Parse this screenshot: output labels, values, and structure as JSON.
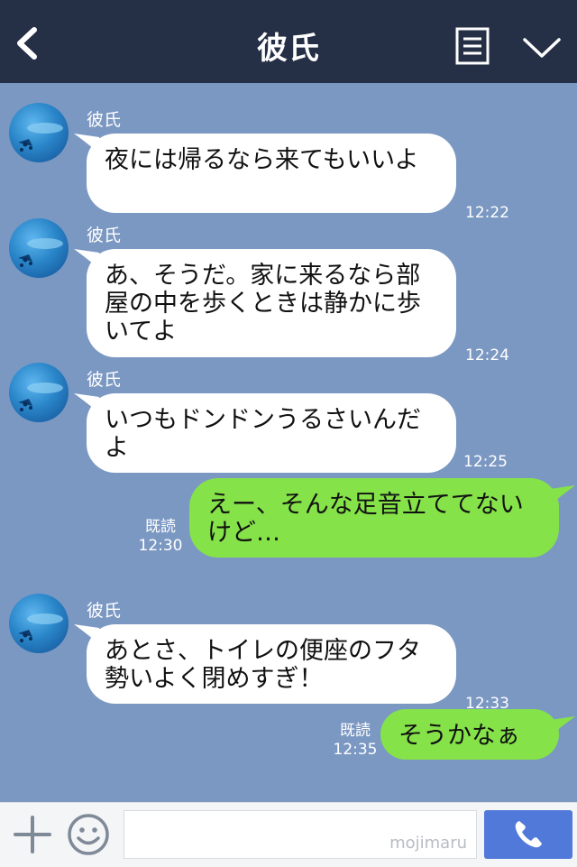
{
  "header": {
    "title": "彼氏",
    "back_icon": "back-chevron-icon",
    "menu_icon": "notes-icon",
    "chevron_icon": "chevron-down-icon",
    "background": "#252f45"
  },
  "chat": {
    "background": "#7b98c3",
    "messages": [
      {
        "direction": "incoming",
        "sender": "彼氏",
        "text": "夜には帰るなら来てもいいよ",
        "time": "12:22"
      },
      {
        "direction": "incoming",
        "sender": "彼氏",
        "text": "あ、そうだ。家に来るなら部屋の中を歩くときは静かに歩いてよ",
        "time": "12:24"
      },
      {
        "direction": "incoming",
        "sender": "彼氏",
        "text": "いつもドンドンうるさいんだよ",
        "time": "12:25"
      },
      {
        "direction": "outgoing",
        "read": "既読",
        "text": "えー、そんな足音立ててないけど…",
        "time": "12:30"
      },
      {
        "direction": "incoming",
        "sender": "彼氏",
        "text": "あとさ、トイレの便座のフタ勢いよく閉めすぎ！",
        "time": "12:33"
      },
      {
        "direction": "outgoing",
        "read": "既読",
        "text": "そうかなぁ",
        "time": "12:35"
      }
    ]
  },
  "input_bar": {
    "plus_icon": "plus-icon",
    "sticker_icon": "smile-icon",
    "watermark": "mojimaru",
    "call_icon": "phone-icon",
    "call_button_color": "#5079d9"
  },
  "colors": {
    "incoming_bubble": "#ffffff",
    "outgoing_bubble": "#85e249"
  }
}
